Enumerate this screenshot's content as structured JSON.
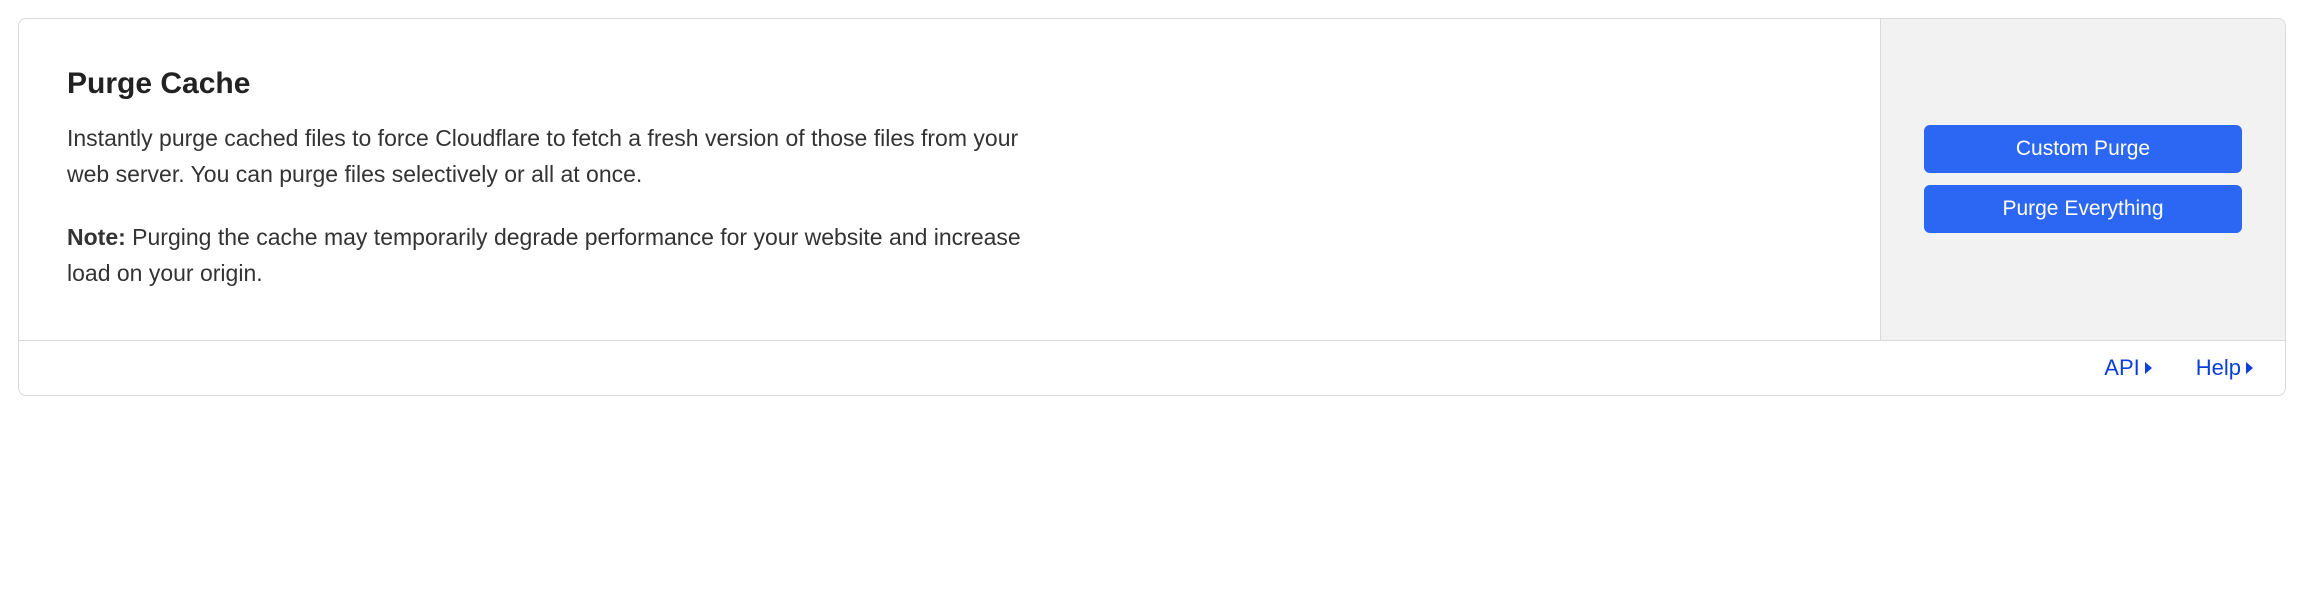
{
  "card": {
    "title": "Purge Cache",
    "description": "Instantly purge cached files to force Cloudflare to fetch a fresh version of those files from your web server. You can purge files selectively or all at once.",
    "note_label": "Note:",
    "note_text": " Purging the cache may temporarily degrade performance for your website and increase load on your origin."
  },
  "actions": {
    "custom_purge_label": "Custom Purge",
    "purge_everything_label": "Purge Everything"
  },
  "footer": {
    "api_label": "API",
    "help_label": "Help"
  },
  "colors": {
    "button_bg": "#2b67f2",
    "link_color": "#0b3fd9",
    "border": "#d9d9d9",
    "panel_bg": "#f2f2f2"
  }
}
